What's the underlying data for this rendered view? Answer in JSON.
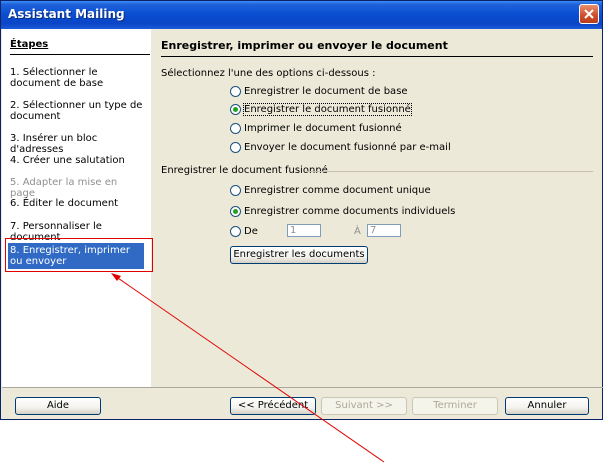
{
  "window": {
    "title": "Assistant Mailing"
  },
  "sidebar": {
    "heading": "Étapes",
    "steps": [
      {
        "label": "1. Sélectionner le document de base"
      },
      {
        "label": "2. Sélectionner un type de document"
      },
      {
        "label": "3. Insérer un bloc d'adresses"
      },
      {
        "label": "4. Créer une salutation"
      },
      {
        "label": "5. Adapter la mise en page"
      },
      {
        "label": "6. Éditer le document"
      },
      {
        "label": "7. Personnaliser le document"
      },
      {
        "label": "8. Enregistrer, imprimer ou envoyer"
      }
    ]
  },
  "main": {
    "heading": "Enregistrer, imprimer ou envoyer le document",
    "instruction": "Sélectionnez l'une des options ci-dessous :",
    "options": [
      {
        "label": "Enregistrer le document de base",
        "checked": false
      },
      {
        "label": "Enregistrer le document fusionné",
        "checked": true
      },
      {
        "label": "Imprimer le document fusionné",
        "checked": false
      },
      {
        "label": "Envoyer le document fusionné par e-mail",
        "checked": false
      }
    ],
    "save_group": {
      "label": "Enregistrer le document fusionné",
      "options": [
        {
          "label": "Enregistrer comme document unique",
          "checked": false
        },
        {
          "label": "Enregistrer comme documents individuels",
          "checked": true
        },
        {
          "label": "De",
          "checked": false
        }
      ],
      "from_value": "1",
      "to_label": "À",
      "to_value": "7",
      "save_button": "Enregistrer les documents"
    }
  },
  "footer": {
    "help": "Aide",
    "previous": "<< Précédent",
    "next": "Suivant >>",
    "finish": "Terminer",
    "cancel": "Annuler"
  },
  "colors": {
    "selection": "#316ac5",
    "annotation": "#e00000"
  }
}
